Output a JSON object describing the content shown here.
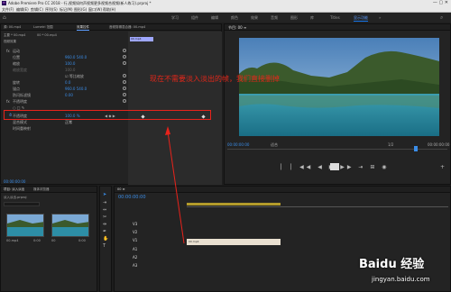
{
  "titlebar": {
    "title": "Adobe Premiere Pro CC 2018 - 行,视频如何声视频更多视频合视频(新人练习).prproj *"
  },
  "menubar": {
    "items": [
      "文件(F)",
      "编辑(E)",
      "剪辑(C)",
      "序列(S)",
      "标记(M)",
      "图形(G)",
      "窗口(W)",
      "帮助(H)"
    ]
  },
  "workspace": {
    "tabs": [
      "学习",
      "组件",
      "编辑",
      "颜色",
      "效果",
      "音频",
      "图形",
      "库",
      "Titles",
      "显示功能"
    ],
    "active": "显示功能",
    "accent": "#1473e6"
  },
  "effect_controls": {
    "tabs": [
      "源: 00.mp4",
      "Lumetri 范围",
      "效果控件",
      "音频剪辑混合器: 00.mp4"
    ],
    "active_tab": "效果控件",
    "source": "主要 * 00.mp4",
    "seq": "00 * 00.mp4",
    "clip_label": "00.mp4",
    "section_video": "视频效果",
    "rows": [
      {
        "name": "运动",
        "value": ""
      },
      {
        "name": "位置",
        "value": "960.0   540.0"
      },
      {
        "name": "缩放",
        "value": "100.0"
      },
      {
        "name": "缩放宽度",
        "value": "100.0"
      },
      {
        "name": "",
        "value": "☑ 等比缩放"
      },
      {
        "name": "旋转",
        "value": "0.0"
      },
      {
        "name": "锚点",
        "value": "960.0   540.0"
      },
      {
        "name": "防闪烁滤镜",
        "value": "0.00"
      },
      {
        "name": "不透明度",
        "value": ""
      },
      {
        "name": "不透明度",
        "value": "100.0 %"
      },
      {
        "name": "混合模式",
        "value": "正常"
      },
      {
        "name": "时间重映射",
        "value": ""
      }
    ],
    "timecode": "00:00:00:00"
  },
  "annotation": "现在不需要淡入淡出的帧，我们直接删掉",
  "program_monitor": {
    "title": "节目: 00 ≡",
    "tc_left": "00:00:00:00",
    "tc_right": "00:00:00:00",
    "fit": "适合",
    "zoom": "1/2"
  },
  "project": {
    "tabs": [
      "项目: 淡入淡出",
      "媒体浏览器"
    ],
    "name": "淡入淡出.prproj",
    "items": [
      {
        "name": "00.mp4",
        "dur": "0:00"
      },
      {
        "name": "00",
        "dur": "0:00"
      }
    ]
  },
  "timeline": {
    "tab": "00 ≡",
    "timecode": "00:00:00:00",
    "tracks": [
      "V3",
      "V2",
      "V1",
      "A1",
      "A2",
      "A3"
    ],
    "clip": "00.mp4"
  },
  "watermark": {
    "brand": "Baidu 经验",
    "url": "jingyan.baidu.com"
  }
}
